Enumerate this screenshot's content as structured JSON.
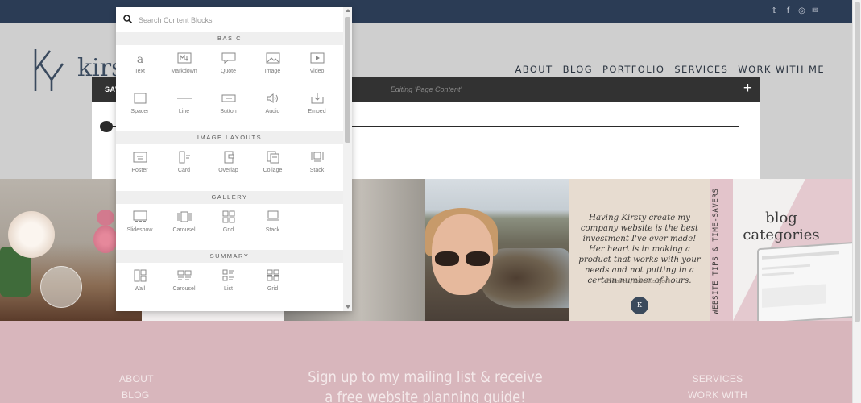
{
  "site": {
    "logo_text": "kirsty",
    "nav": [
      "ABOUT",
      "BLOG",
      "PORTFOLIO",
      "SERVICES",
      "WORK WITH ME"
    ],
    "social_icons": [
      "twitter-icon",
      "facebook-icon",
      "instagram-icon",
      "email-icon"
    ]
  },
  "editor": {
    "save_label": "SAV",
    "title": "Editing 'Page Content'",
    "add_label": "+"
  },
  "block_menu": {
    "search_placeholder": "Search Content Blocks",
    "sections": [
      {
        "title": "BASIC",
        "rows": [
          [
            {
              "label": "Text",
              "icon": "text-icon"
            },
            {
              "label": "Markdown",
              "icon": "markdown-icon"
            },
            {
              "label": "Quote",
              "icon": "quote-icon"
            },
            {
              "label": "Image",
              "icon": "image-icon"
            },
            {
              "label": "Video",
              "icon": "video-icon"
            }
          ],
          [
            {
              "label": "Spacer",
              "icon": "spacer-icon"
            },
            {
              "label": "Line",
              "icon": "line-icon"
            },
            {
              "label": "Button",
              "icon": "button-icon"
            },
            {
              "label": "Audio",
              "icon": "audio-icon"
            },
            {
              "label": "Embed",
              "icon": "embed-icon"
            }
          ]
        ]
      },
      {
        "title": "IMAGE LAYOUTS",
        "rows": [
          [
            {
              "label": "Poster",
              "icon": "poster-icon"
            },
            {
              "label": "Card",
              "icon": "card-icon"
            },
            {
              "label": "Overlap",
              "icon": "overlap-icon"
            },
            {
              "label": "Collage",
              "icon": "collage-icon"
            },
            {
              "label": "Stack",
              "icon": "stack-icon"
            }
          ]
        ]
      },
      {
        "title": "GALLERY",
        "rows": [
          [
            {
              "label": "Slideshow",
              "icon": "slideshow-icon"
            },
            {
              "label": "Carousel",
              "icon": "carousel-icon"
            },
            {
              "label": "Grid",
              "icon": "grid-icon"
            },
            {
              "label": "Stack",
              "icon": "gallery-stack-icon"
            }
          ]
        ]
      },
      {
        "title": "SUMMARY",
        "rows": [
          [
            {
              "label": "Wall",
              "icon": "wall-icon"
            },
            {
              "label": "Carousel",
              "icon": "summary-carousel-icon"
            },
            {
              "label": "List",
              "icon": "list-icon"
            },
            {
              "label": "Grid",
              "icon": "summary-grid-icon"
            }
          ]
        ]
      }
    ]
  },
  "banner": {
    "testimonial_quote": "Having Kirsty create my company website is the best investment I've ever made! Her heart is in making a product that works with your needs and not putting in a certain number of hours.",
    "testimonial_author": "Elizabeth, Delicious Decor",
    "badge_text": "K",
    "tips_vertical": "WEBSITE TIPS & TIME-SAVERS",
    "blog_categories": "blog categories"
  },
  "footer": {
    "left_links": [
      "ABOUT",
      "BLOG"
    ],
    "signup": "Sign up to my mailing list & receive a free website planning guide!",
    "right_links": [
      "SERVICES",
      "WORK WITH ME"
    ]
  },
  "colors": {
    "topbar": "#2b3c55",
    "editor_bar": "#323232",
    "footer": "#d8b6bc",
    "menu_section": "#efefef"
  }
}
